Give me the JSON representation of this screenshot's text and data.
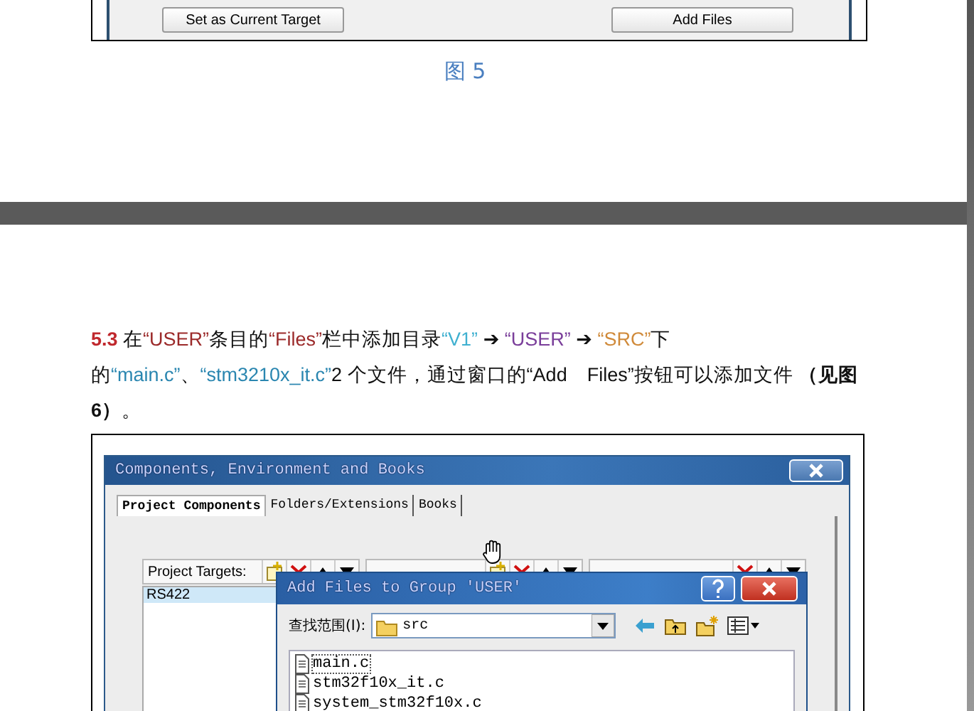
{
  "page_1": {
    "buttons": [
      {
        "label": "Set as Current Target"
      },
      {
        "label": "Add Files"
      }
    ],
    "caption": "图 5"
  },
  "page_2": {
    "paragraph": [
      {
        "text": "5.3",
        "bold": true,
        "color": "#c0282d"
      },
      {
        "text": " 在"
      },
      {
        "text": "“USER”",
        "color": "#9b2a2a"
      },
      {
        "text": "条目的"
      },
      {
        "text": "“Files”",
        "color": "#9b2a2a"
      },
      {
        "text": "栏中添加目录"
      },
      {
        "text": "“V1”",
        "color": "#3fb0d0"
      },
      {
        "text": " ➔ ",
        "bold": true
      },
      {
        "text": "“USER”",
        "color": "#7a3e9a"
      },
      {
        "text": " ➔ ",
        "bold": true
      },
      {
        "text": "“SRC”",
        "color": "#d08a3a"
      },
      {
        "text": "下的"
      },
      {
        "text": "“main.c”",
        "color": "#2a86b0"
      },
      {
        "text": "、"
      },
      {
        "text": "“stm3210x_it.c”",
        "color": "#2a86b0"
      },
      {
        "text": "2 个文件，通过窗口的“Add　Files”按钮可以添加文件 "
      },
      {
        "text": "（见图 6）",
        "bold": true
      },
      {
        "text": "。"
      }
    ],
    "figure": {
      "window": {
        "title": "Components, Environment and Books"
      },
      "tabs": [
        {
          "label": "Project Components",
          "selected": true
        },
        {
          "label": "Folders/Extensions",
          "selected": false
        },
        {
          "label": "Books",
          "selected": false
        }
      ],
      "targets": {
        "label": "Project Targets:",
        "items": [
          {
            "label": "RS422",
            "selected": true
          }
        ]
      },
      "add_dialog": {
        "title": "Add Files to Group 'USER'",
        "look_in_label": "查找范围(I):",
        "look_in_value": "src",
        "files": [
          {
            "name": "main.c",
            "selected": true
          },
          {
            "name": "stm32f10x_it.c",
            "selected": false
          },
          {
            "name": "system_stm32f10x.c",
            "selected": false
          }
        ]
      }
    }
  }
}
